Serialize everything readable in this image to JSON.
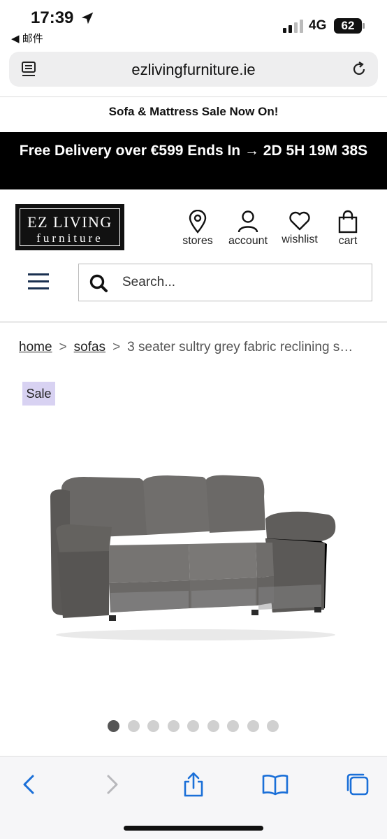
{
  "status_bar": {
    "time": "17:39",
    "back_app": "◀ 邮件",
    "network": "4G",
    "battery": "62"
  },
  "browser": {
    "url": "ezlivingfurniture.ie"
  },
  "promo_text": "Sofa & Mattress Sale Now On!",
  "delivery_banner": "Free Delivery over €599 Ends In → 2D 5H 19M 38S",
  "logo": {
    "line1": "EZ LIVING",
    "line2": "furniture"
  },
  "header_nav": [
    {
      "label": "stores",
      "icon": "location-pin-icon"
    },
    {
      "label": "account",
      "icon": "user-icon"
    },
    {
      "label": "wishlist",
      "icon": "heart-icon"
    },
    {
      "label": "cart",
      "icon": "bag-icon"
    }
  ],
  "search": {
    "placeholder": "Search..."
  },
  "breadcrumb": {
    "home": "home",
    "sep": ">",
    "sofas": "sofas",
    "current": "3 seater sultry grey fabric reclining s…"
  },
  "badge": "Sale",
  "carousel": {
    "total": 9,
    "active": 1
  },
  "colors": {
    "banner_bg": "#000000",
    "sale_badge": "#d8d2f2",
    "link_blue": "#1a6fd8",
    "navy": "#1a3050"
  }
}
